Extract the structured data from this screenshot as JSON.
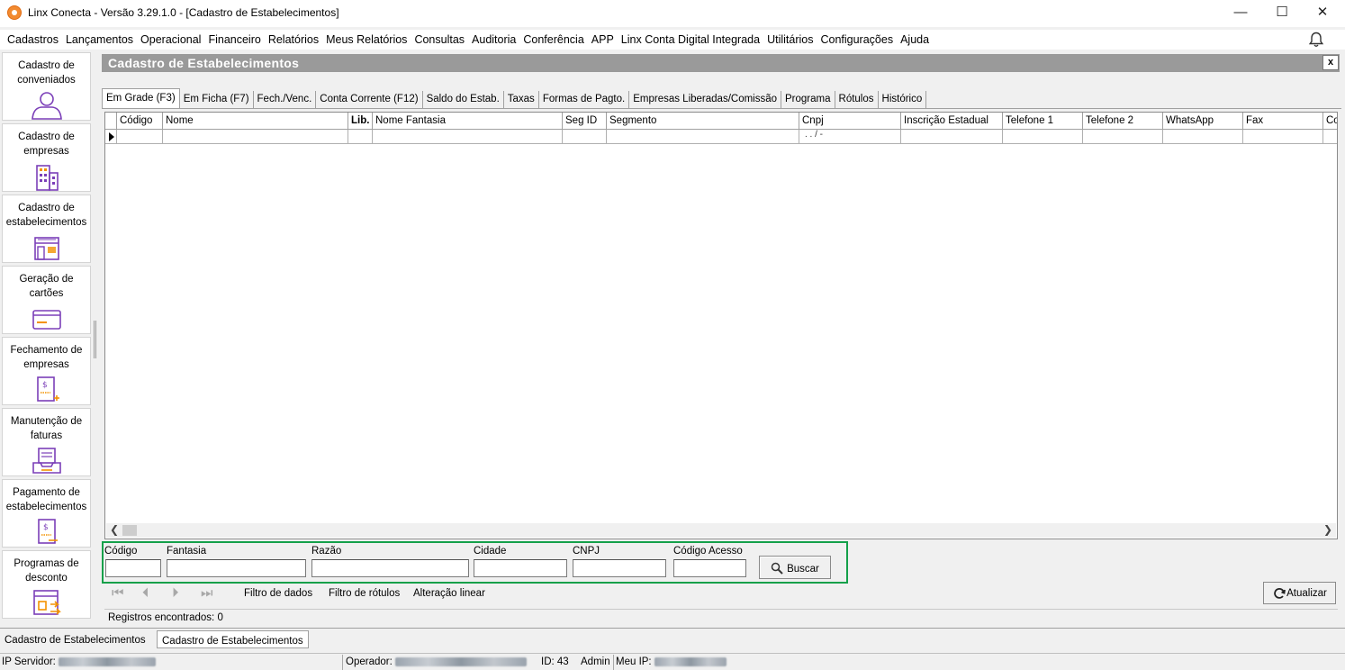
{
  "window": {
    "title": "Linx Conecta - Versão 3.29.1.0 - [Cadastro de Estabelecimentos]",
    "minimize": "—",
    "maximize": "☐",
    "close": "✕"
  },
  "menu": [
    "Cadastros",
    "Lançamentos",
    "Operacional",
    "Financeiro",
    "Relatórios",
    "Meus Relatórios",
    "Consultas",
    "Auditoria",
    "Conferência",
    "APP",
    "Linx Conta Digital Integrada",
    "Utilitários",
    "Configurações",
    "Ajuda"
  ],
  "sidebar": {
    "items": [
      {
        "label": "Cadastro de conveniados",
        "icon": "user-icon"
      },
      {
        "label": "Cadastro de empresas",
        "icon": "building-icon"
      },
      {
        "label": "Cadastro de estabelecimentos",
        "icon": "store-icon"
      },
      {
        "label": "Geração de cartões",
        "icon": "card-icon"
      },
      {
        "label": "Fechamento de empresas",
        "icon": "invoice-add-icon"
      },
      {
        "label": "Manutenção de faturas",
        "icon": "inbox-tray-icon"
      },
      {
        "label": "Pagamento de estabelecimentos",
        "icon": "invoice-pay-icon"
      },
      {
        "label": "Programas de desconto",
        "icon": "discount-program-icon"
      }
    ],
    "accent_color": "#7b3fb8",
    "secondary_color": "#f39200"
  },
  "panel": {
    "title": "Cadastro de Estabelecimentos",
    "close": "x"
  },
  "tabs": [
    "Em Grade (F3)",
    "Em Ficha (F7)",
    "Fech./Venc.",
    "Conta Corrente (F12)",
    "Saldo do Estab.",
    "Taxas",
    "Formas de Pagto.",
    "Empresas Liberadas/Comissão",
    "Programa",
    "Rótulos",
    "Histórico"
  ],
  "grid": {
    "columns": [
      "Código",
      "Nome",
      "Lib.",
      "Nome Fantasia",
      "Seg ID",
      "Segmento",
      "Cnpj",
      "Inscrição Estadual",
      "Telefone 1",
      "Telefone 2",
      "WhatsApp",
      "Fax",
      "Co"
    ],
    "row_mask": ". . /  -"
  },
  "search": {
    "fields": [
      {
        "label": "Código",
        "value": ""
      },
      {
        "label": "Fantasia",
        "value": ""
      },
      {
        "label": "Razão",
        "value": ""
      },
      {
        "label": "Cidade",
        "value": ""
      },
      {
        "label": "CNPJ",
        "value": ""
      },
      {
        "label": "Código Acesso",
        "value": ""
      }
    ],
    "button": "Buscar",
    "border_color": "#14a04a"
  },
  "actions": {
    "filtro_dados": "Filtro de dados",
    "filtro_rotulos": "Filtro de rótulos",
    "alteracao_linear": "Alteração linear",
    "atualizar": "Atualizar"
  },
  "records": "Registros encontrados: 0",
  "window_tabs": [
    "Cadastro de Estabelecimentos",
    "Cadastro de Estabelecimentos"
  ],
  "status": {
    "ip_servidor_label": "IP Servidor:",
    "operador_label": "Operador:",
    "id": "ID: 43",
    "role": "Admin",
    "meu_ip_label": "Meu IP:"
  }
}
